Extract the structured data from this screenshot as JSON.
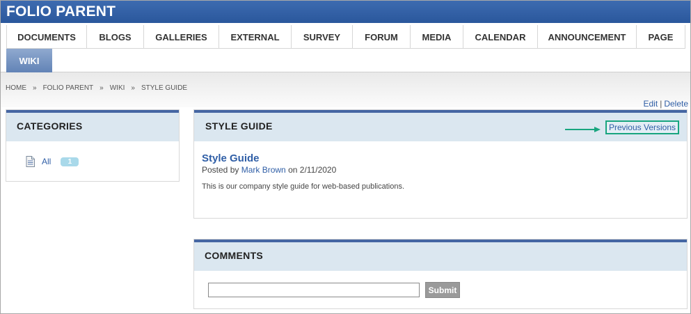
{
  "header": {
    "title": "FOLIO PARENT"
  },
  "nav": {
    "row1": [
      {
        "label": "DOCUMENTS"
      },
      {
        "label": "BLOGS"
      },
      {
        "label": "GALLERIES"
      },
      {
        "label": "EXTERNAL"
      },
      {
        "label": "SURVEY"
      },
      {
        "label": "FORUM"
      },
      {
        "label": "MEDIA"
      },
      {
        "label": "CALENDAR"
      },
      {
        "label": "ANNOUNCEMENT"
      },
      {
        "label": "PAGE"
      }
    ],
    "row2": [
      {
        "label": "WIKI",
        "active": true
      }
    ]
  },
  "breadcrumb": [
    "HOME",
    "FOLIO PARENT",
    "WIKI",
    "STYLE GUIDE"
  ],
  "breadcrumb_separator": "»",
  "actions": {
    "edit": "Edit",
    "separator": "|",
    "delete": "Delete"
  },
  "categories": {
    "title": "CATEGORIES",
    "items": [
      {
        "label": "All",
        "count": "1",
        "icon": "document-icon"
      }
    ]
  },
  "style_guide": {
    "title": "STYLE GUIDE",
    "previous_versions": "Previous Versions",
    "post": {
      "title": "Style Guide",
      "posted_by_prefix": "Posted by",
      "author": "Mark Brown",
      "date_prefix": "on",
      "date": "2/11/2020",
      "body": "This is our company style guide for web-based publications."
    }
  },
  "comments": {
    "title": "COMMENTS",
    "input_value": "",
    "submit_label": "Submit"
  },
  "colors": {
    "header_blue": "#2a579c",
    "panel_head": "#dbe7f0",
    "panel_accent": "#4566a3",
    "link": "#2f5ea6",
    "highlight": "#18a57f"
  }
}
